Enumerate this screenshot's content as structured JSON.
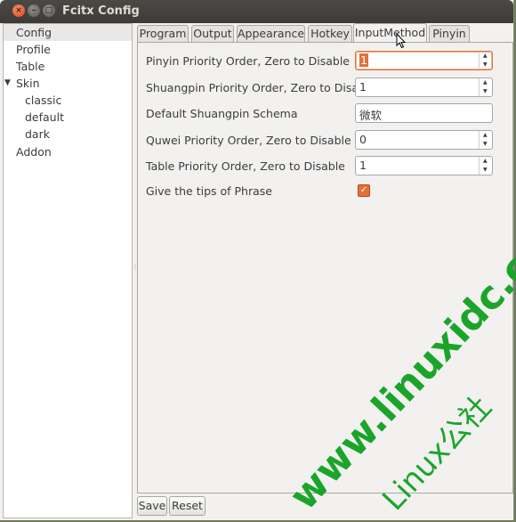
{
  "window": {
    "title": "Fcitx Config",
    "close_glyph": "×",
    "min_glyph": "–",
    "max_glyph": "□"
  },
  "sidebar": {
    "items": [
      {
        "label": "Config",
        "selected": true
      },
      {
        "label": "Profile"
      },
      {
        "label": "Table"
      },
      {
        "label": "Skin",
        "expanded": true
      },
      {
        "label": "classic"
      },
      {
        "label": "default"
      },
      {
        "label": "dark"
      },
      {
        "label": "Addon"
      }
    ]
  },
  "tabs": [
    "Program",
    "Output",
    "Appearance",
    "Hotkey",
    "InputMethod",
    "Pinyin"
  ],
  "active_tab": "InputMethod",
  "form": {
    "pinyin_label": "Pinyin Priority Order, Zero to Disable",
    "pinyin_value": "1",
    "shuangpin_label": "Shuangpin Priority Order, Zero to Disable",
    "shuangpin_value": "1",
    "schema_label": "Default Shuangpin Schema",
    "schema_value": "微软",
    "quwei_label": "Quwei Priority Order, Zero to Disable",
    "quwei_value": "0",
    "table_label": "Table Priority Order, Zero to Disable",
    "table_value": "1",
    "tips_label": "Give the tips of Phrase",
    "tips_checked": true
  },
  "buttons": {
    "save": "Save",
    "reset": "Reset"
  },
  "watermark": {
    "url": "www.linuxidc.com",
    "brand": "Linux公社",
    "color": "#1aa52a"
  },
  "colors": {
    "accent": "#e86f37",
    "titlebar": "#3c3b37"
  }
}
